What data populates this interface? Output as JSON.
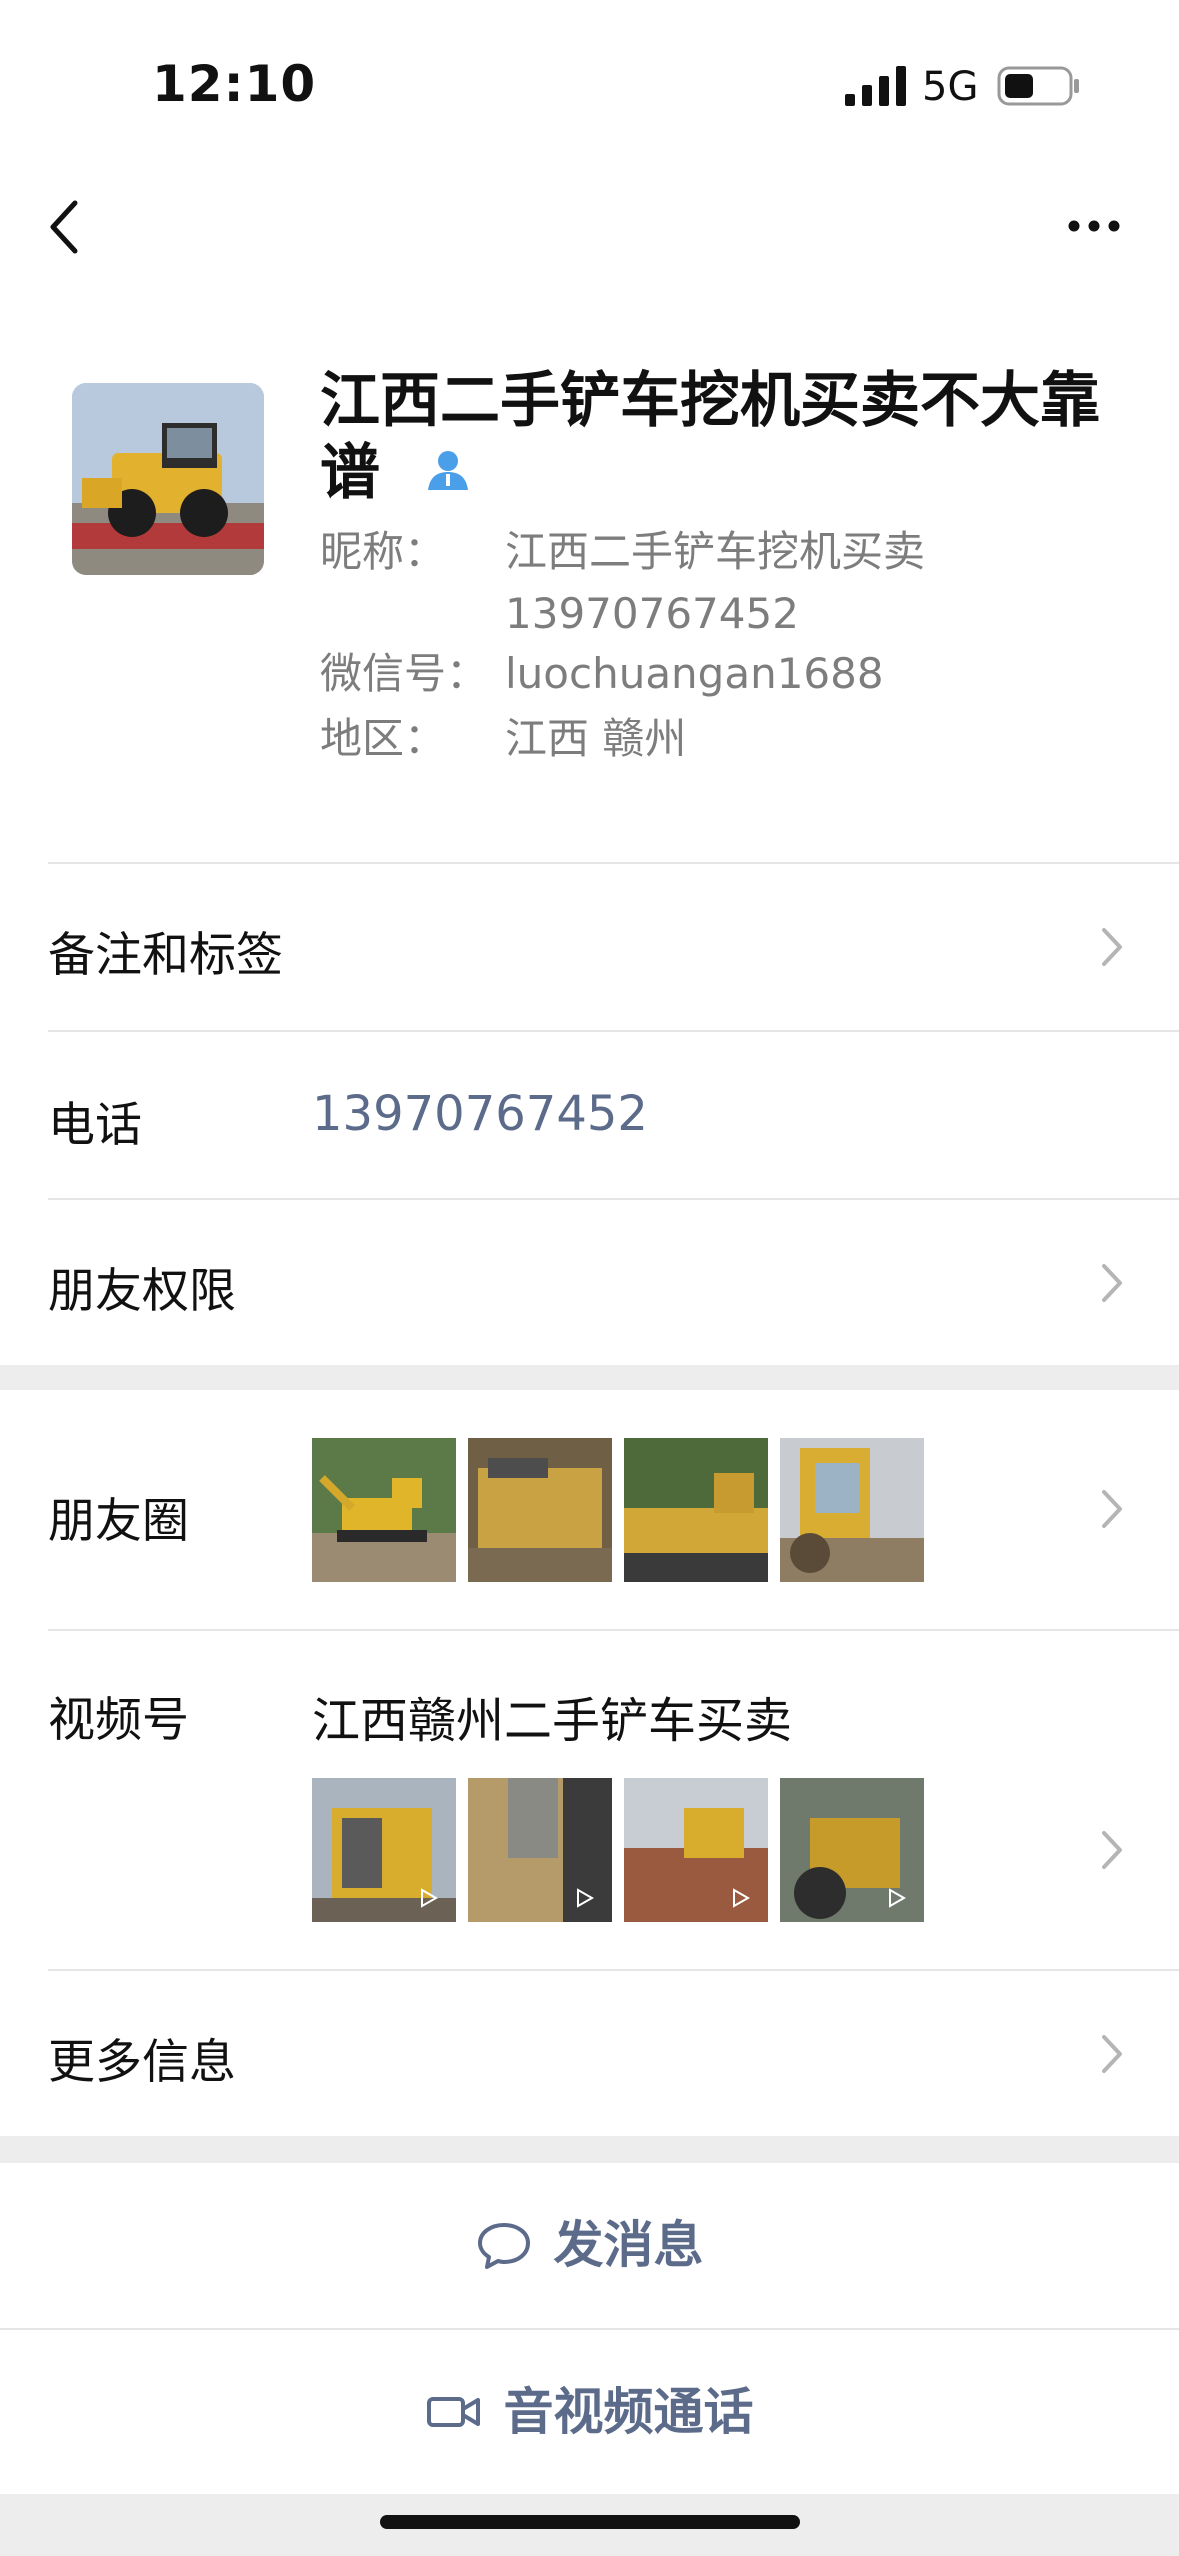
{
  "status_bar": {
    "time": "12:10",
    "network": "5G"
  },
  "profile": {
    "name": "江西二手铲车挖机买卖不大靠谱",
    "nickname_label": "昵称：",
    "nickname_line1": "江西二手铲车挖机买卖",
    "nickname_line2": "13970767452",
    "wechat_id_label": "微信号：",
    "wechat_id": "luochuangan1688",
    "region_label": "地区：",
    "region": "江西 赣州"
  },
  "rows": {
    "remarks_label": "备注和标签",
    "phone_label": "电话",
    "phone_value": "13970767452",
    "permissions_label": "朋友权限",
    "moments_label": "朋友圈",
    "channels_label": "视频号",
    "channels_title": "江西赣州二手铲车买卖",
    "more_info_label": "更多信息"
  },
  "actions": {
    "message_label": "发消息",
    "call_label": "音视频通话"
  },
  "colors": {
    "link_blue": "#5c6b8a",
    "gray_text": "#7d7d7d",
    "separator": "#ededed",
    "verified_blue": "#4a9fe8"
  }
}
